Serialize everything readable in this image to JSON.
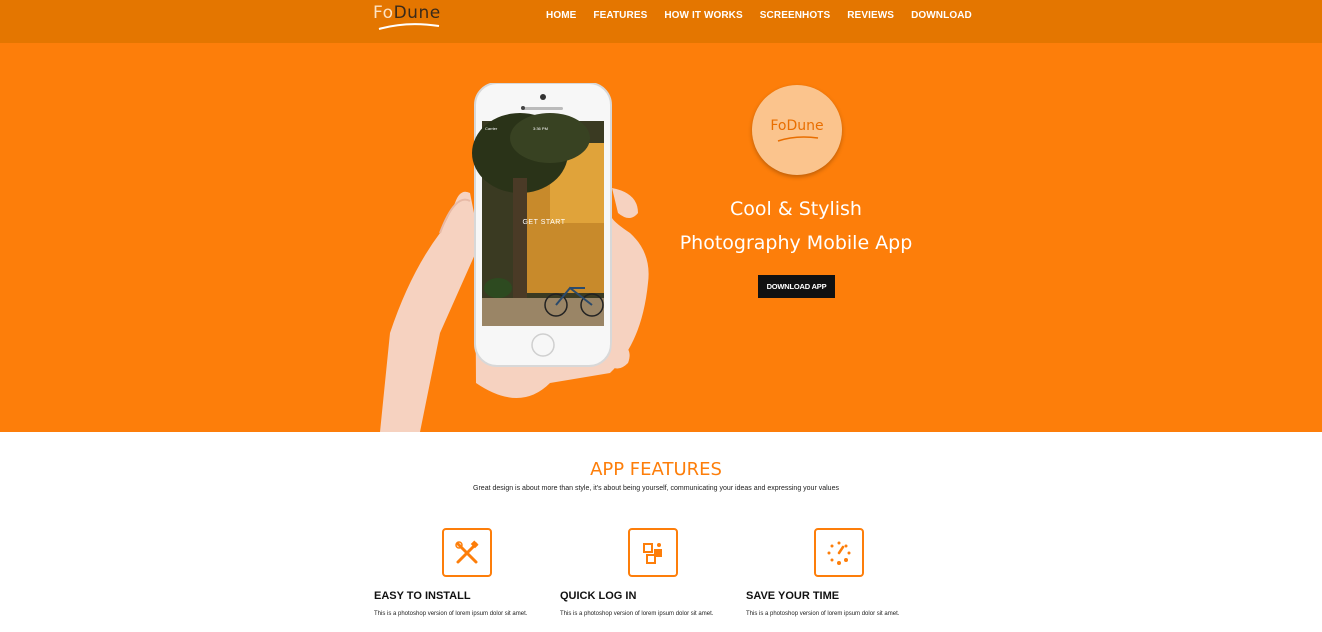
{
  "brand": {
    "logo_prefix": "Fo",
    "logo_suffix": "Dune",
    "badge_text": "FoDune"
  },
  "nav": {
    "items": [
      "HOME",
      "FEATURES",
      "HOW IT WORKS",
      "SCREENHOTS",
      "REVIEWS",
      "DOWNLOAD"
    ]
  },
  "hero": {
    "phone_carrier": "Carrier",
    "phone_time": "3:36 PM",
    "phone_screen_label": "GET START",
    "title_line1": "Cool & Stylish",
    "title_line2": "Photography Mobile App",
    "download_label": "DOWNLOAD APP"
  },
  "features": {
    "title": "APP FEATURES",
    "subtitle": "Great design is about more than style, it's about being yourself, communicating your ideas and expressing your values",
    "items": [
      {
        "icon": "tools-icon",
        "heading": "EASY TO INSTALL",
        "text": "This is a photoshop version of lorem ipsum dolor sit amet."
      },
      {
        "icon": "login-puzzle-icon",
        "heading": "QUICK LOG IN",
        "text": "This is a photoshop version of lorem ipsum dolor sit amet."
      },
      {
        "icon": "stopwatch-icon",
        "heading": "SAVE YOUR TIME",
        "text": "This is a photoshop version of lorem ipsum dolor sit amet."
      }
    ]
  },
  "colors": {
    "nav_bg": "#e47600",
    "hero_bg": "#fd7e0a",
    "accent": "#fd7e0a",
    "button_bg": "#111111"
  }
}
